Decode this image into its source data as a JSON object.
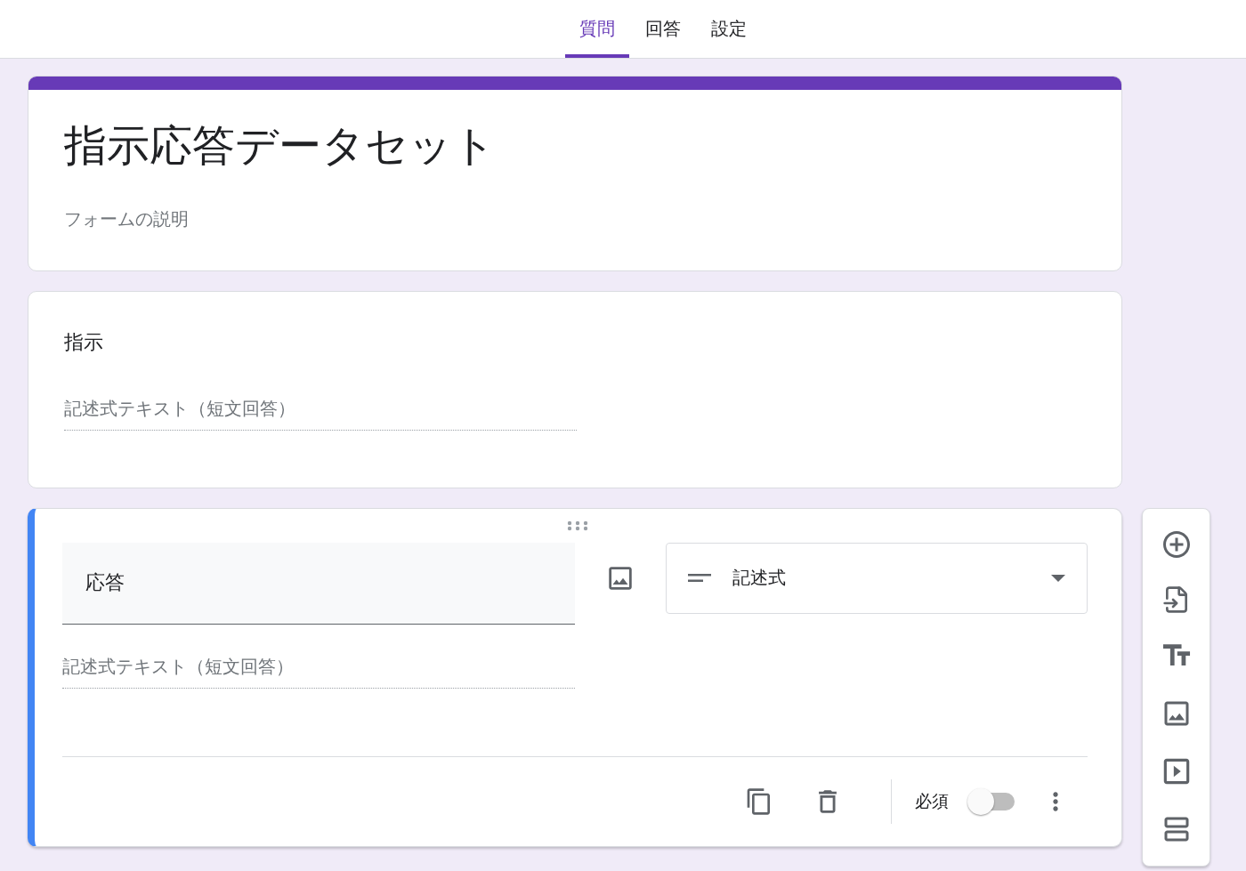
{
  "tabs": [
    {
      "label": "質問",
      "selected": true
    },
    {
      "label": "回答",
      "selected": false
    },
    {
      "label": "設定",
      "selected": false
    }
  ],
  "form": {
    "title": "指示応答データセット",
    "description_placeholder": "フォームの説明"
  },
  "questions": [
    {
      "title": "指示",
      "answer_placeholder": "記述式テキスト（短文回答）",
      "active": false
    },
    {
      "title": "応答",
      "answer_placeholder": "記述式テキスト（短文回答）",
      "active": true,
      "type": "記述式",
      "required_label": "必須",
      "required": false
    }
  ]
}
